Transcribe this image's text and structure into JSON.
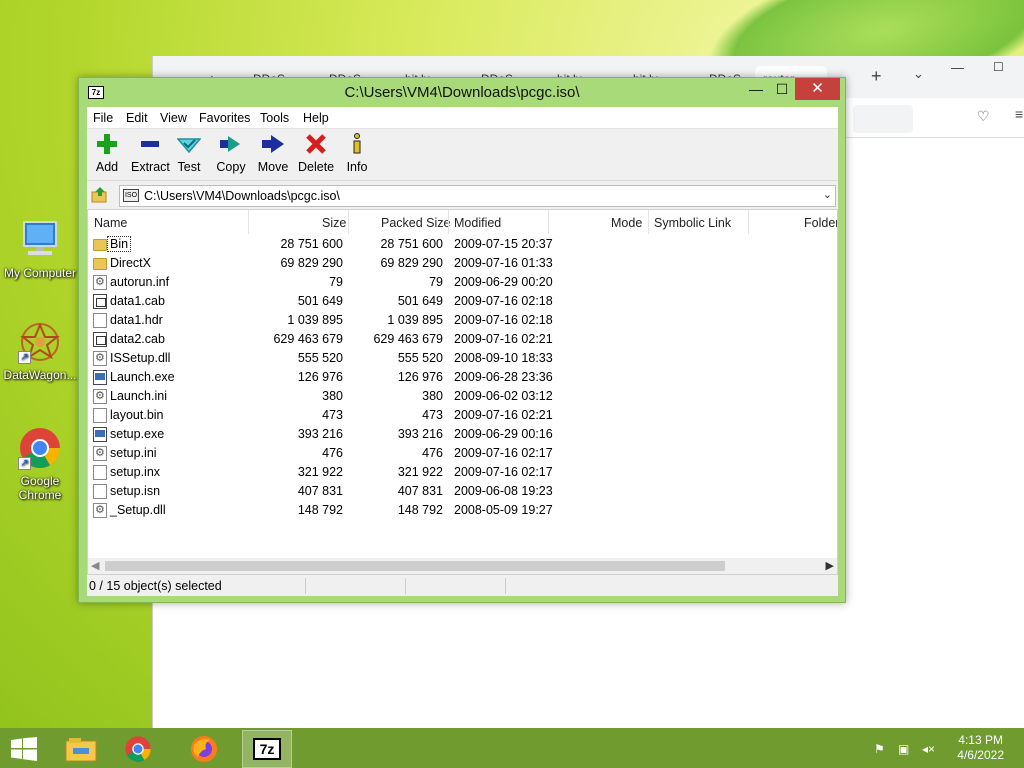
{
  "desktop": {
    "icons": [
      {
        "label": "My Computer"
      },
      {
        "label": "DataWagon..."
      },
      {
        "label": "Google Chrome"
      }
    ]
  },
  "browser": {
    "tabs": [
      "DDoS",
      "DDoS",
      "bit.ly",
      "DDoS",
      "bit.ly",
      "bit.ly",
      "DDoS",
      "router"
    ]
  },
  "window": {
    "title": "C:\\Users\\VM4\\Downloads\\pcgc.iso\\",
    "app_icon_text": "7z",
    "minimize": "—",
    "maximize": "☐",
    "close": "✕"
  },
  "menu": [
    "File",
    "Edit",
    "View",
    "Favorites",
    "Tools",
    "Help"
  ],
  "toolbar": [
    {
      "label": "Add",
      "icon": "plus-icon",
      "color": "#1aa31a"
    },
    {
      "label": "Extract",
      "icon": "minus-icon",
      "color": "#1d2f9e"
    },
    {
      "label": "Test",
      "icon": "check-icon",
      "color": "#1bb7c9"
    },
    {
      "label": "Copy",
      "icon": "copy-arrow-icon",
      "color": "#1a9c8a"
    },
    {
      "label": "Move",
      "icon": "move-arrow-icon",
      "color": "#1d2f9e"
    },
    {
      "label": "Delete",
      "icon": "delete-x-icon",
      "color": "#d81d1d"
    },
    {
      "label": "Info",
      "icon": "info-icon",
      "color": "#e0c020"
    }
  ],
  "address": {
    "icon_text": "ISO",
    "path": "C:\\Users\\VM4\\Downloads\\pcgc.iso\\"
  },
  "columns": [
    "Name",
    "Size",
    "Packed Size",
    "Modified",
    "Mode",
    "Symbolic Link",
    "Folder"
  ],
  "files": [
    {
      "name": "Bin",
      "size": "28 751 600",
      "packed": "28 751 600",
      "modified": "2009-07-15 20:37",
      "icon": "folder-icon"
    },
    {
      "name": "DirectX",
      "size": "69 829 290",
      "packed": "69 829 290",
      "modified": "2009-07-16 01:33",
      "icon": "folder-icon"
    },
    {
      "name": "autorun.inf",
      "size": "79",
      "packed": "79",
      "modified": "2009-06-29 00:20",
      "icon": "settings-file-icon"
    },
    {
      "name": "data1.cab",
      "size": "501 649",
      "packed": "501 649",
      "modified": "2009-07-16 02:18",
      "icon": "cab-file-icon"
    },
    {
      "name": "data1.hdr",
      "size": "1 039 895",
      "packed": "1 039 895",
      "modified": "2009-07-16 02:18",
      "icon": "file-icon"
    },
    {
      "name": "data2.cab",
      "size": "629 463 679",
      "packed": "629 463 679",
      "modified": "2009-07-16 02:21",
      "icon": "cab-file-icon"
    },
    {
      "name": "ISSetup.dll",
      "size": "555 520",
      "packed": "555 520",
      "modified": "2008-09-10 18:33",
      "icon": "settings-file-icon"
    },
    {
      "name": "Launch.exe",
      "size": "126 976",
      "packed": "126 976",
      "modified": "2009-06-28 23:36",
      "icon": "exe-file-icon"
    },
    {
      "name": "Launch.ini",
      "size": "380",
      "packed": "380",
      "modified": "2009-06-02 03:12",
      "icon": "settings-file-icon"
    },
    {
      "name": "layout.bin",
      "size": "473",
      "packed": "473",
      "modified": "2009-07-16 02:21",
      "icon": "file-icon"
    },
    {
      "name": "setup.exe",
      "size": "393 216",
      "packed": "393 216",
      "modified": "2009-06-29 00:16",
      "icon": "exe-file-icon"
    },
    {
      "name": "setup.ini",
      "size": "476",
      "packed": "476",
      "modified": "2009-07-16 02:17",
      "icon": "settings-file-icon"
    },
    {
      "name": "setup.inx",
      "size": "321 922",
      "packed": "321 922",
      "modified": "2009-07-16 02:17",
      "icon": "file-icon"
    },
    {
      "name": "setup.isn",
      "size": "407 831",
      "packed": "407 831",
      "modified": "2009-06-08 19:23",
      "icon": "file-icon"
    },
    {
      "name": "_Setup.dll",
      "size": "148 792",
      "packed": "148 792",
      "modified": "2008-05-09 19:27",
      "icon": "settings-file-icon"
    }
  ],
  "status": "0 / 15 object(s) selected",
  "taskbar": {
    "apps": [
      "file-explorer-icon",
      "chrome-icon",
      "firefox-icon",
      "7zip-icon"
    ],
    "sevenzip_text": "7z",
    "time": "4:13 PM",
    "date": "4/6/2022"
  }
}
